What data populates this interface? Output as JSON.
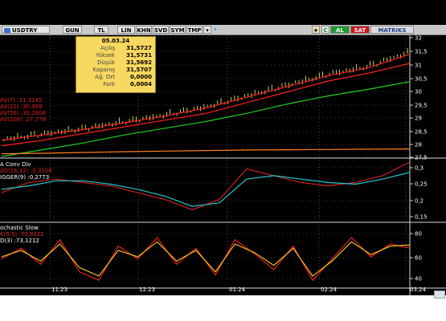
{
  "toolbar": {
    "symbol": "USDTRY",
    "buttons": [
      "GUN",
      "TL",
      "LIN",
      "KHN",
      "SVD",
      "SYM",
      "TMP"
    ],
    "al_label": "AL",
    "sat_label": "SAT",
    "matriks_label": "MATRIKS",
    "refresh_label": "C"
  },
  "info_box": {
    "date": "05.03.24",
    "rows": [
      {
        "label": "Açılış",
        "value": "31,5727"
      },
      {
        "label": "Yüksek",
        "value": "31,5731"
      },
      {
        "label": "Düşük",
        "value": "31,5692"
      },
      {
        "label": "Kapanış",
        "value": "31,5707"
      },
      {
        "label": "Ağ. Ort",
        "value": "0,0000"
      },
      {
        "label": "Fark",
        "value": "0,0004"
      }
    ]
  },
  "price_legend": [
    {
      "name": "AV(7)",
      "value": ":31,3145",
      "color": "#e02020"
    },
    {
      "name": "AV(21)",
      "value": ":30,958",
      "color": "#e02020"
    },
    {
      "name": "AV(56)",
      "value": ":30,2806",
      "color": "#e02020"
    },
    {
      "name": "AV(200)",
      "value": ":27,778",
      "color": "#e02020"
    }
  ],
  "macd_legend": {
    "title": "A Conv Div",
    "lines": [
      {
        "name": "AD(26,12)",
        "value": ":0,3108",
        "color": "#e02020"
      },
      {
        "name": "IGGER(9)",
        "value": ":0,2773",
        "color": "#ffffff"
      }
    ]
  },
  "stoch_legend": {
    "title": "ochastic Slow",
    "lines": [
      {
        "name": "K(5,5)",
        "value": ":70,8322",
        "color": "#e02020"
      },
      {
        "name": "D(3)",
        "value": ":73,1212",
        "color": "#ffffff"
      }
    ]
  },
  "x_axis_labels": [
    "11.23",
    "12.23",
    "01.24",
    "02.24",
    "03.24"
  ],
  "colors": {
    "background": "#000000",
    "candle": "#ffff66",
    "ma_fast": "#ff2020",
    "ma_mid": "#20d020",
    "ma_slow": "#ff8020",
    "ma_200": "#c020c0",
    "macd_line": "#d02020",
    "signal_line": "#20c8d0",
    "stoch_k": "#ff2020",
    "stoch_d": "#ffd020",
    "grid_dot": "#808080"
  },
  "chart_data": [
    {
      "type": "line",
      "title": "",
      "y_ticks": [
        "32",
        "31,5",
        "31",
        "30,5",
        "30",
        "29,5",
        "29",
        "28,5",
        "28",
        "27,5"
      ],
      "ylim": [
        27.5,
        32.0
      ],
      "x_labels": [
        "11.23",
        "12.23",
        "01.24",
        "02.24",
        "03.24"
      ],
      "series": [
        {
          "name": "AV(7)",
          "values": [
            28.1,
            28.3,
            28.5,
            28.75,
            29.0,
            29.3,
            29.7,
            30.1,
            30.5,
            30.8,
            31.3
          ]
        },
        {
          "name": "AV(21)",
          "values": [
            27.9,
            28.1,
            28.35,
            28.6,
            28.85,
            29.1,
            29.5,
            29.9,
            30.3,
            30.6,
            30.96
          ]
        },
        {
          "name": "AV(56)",
          "values": [
            27.5,
            27.75,
            28.0,
            28.3,
            28.55,
            28.8,
            29.1,
            29.45,
            29.75,
            30.0,
            30.28
          ]
        },
        {
          "name": "AV(200)",
          "values": [
            27.6,
            27.62,
            27.65,
            27.68,
            27.7,
            27.72,
            27.74,
            27.75,
            27.76,
            27.77,
            27.78
          ]
        }
      ]
    },
    {
      "type": "line",
      "y_ticks": [
        "0,3",
        "0,25",
        "0,2",
        "0,15"
      ],
      "ylim": [
        0.14,
        0.31
      ],
      "series": [
        {
          "name": "AD(26,12)",
          "values": [
            0.22,
            0.25,
            0.26,
            0.25,
            0.24,
            0.22,
            0.2,
            0.17,
            0.2,
            0.29,
            0.27,
            0.25,
            0.24,
            0.25,
            0.27,
            0.31
          ]
        },
        {
          "name": "IGGER(9)",
          "values": [
            0.23,
            0.24,
            0.255,
            0.255,
            0.245,
            0.23,
            0.21,
            0.18,
            0.19,
            0.26,
            0.27,
            0.26,
            0.25,
            0.245,
            0.26,
            0.28
          ]
        }
      ]
    },
    {
      "type": "line",
      "y_ticks": [
        "80",
        "60",
        "40"
      ],
      "ylim": [
        35,
        92
      ],
      "series": [
        {
          "name": "K(5,5)",
          "values": [
            60,
            70,
            55,
            78,
            48,
            40,
            72,
            60,
            80,
            55,
            70,
            45,
            78,
            65,
            50,
            72,
            40,
            60,
            80,
            62,
            74,
            70
          ]
        },
        {
          "name": "D(3)",
          "values": [
            62,
            68,
            58,
            74,
            52,
            44,
            68,
            62,
            76,
            58,
            68,
            48,
            74,
            66,
            54,
            70,
            44,
            58,
            76,
            64,
            72,
            73
          ]
        }
      ]
    }
  ]
}
